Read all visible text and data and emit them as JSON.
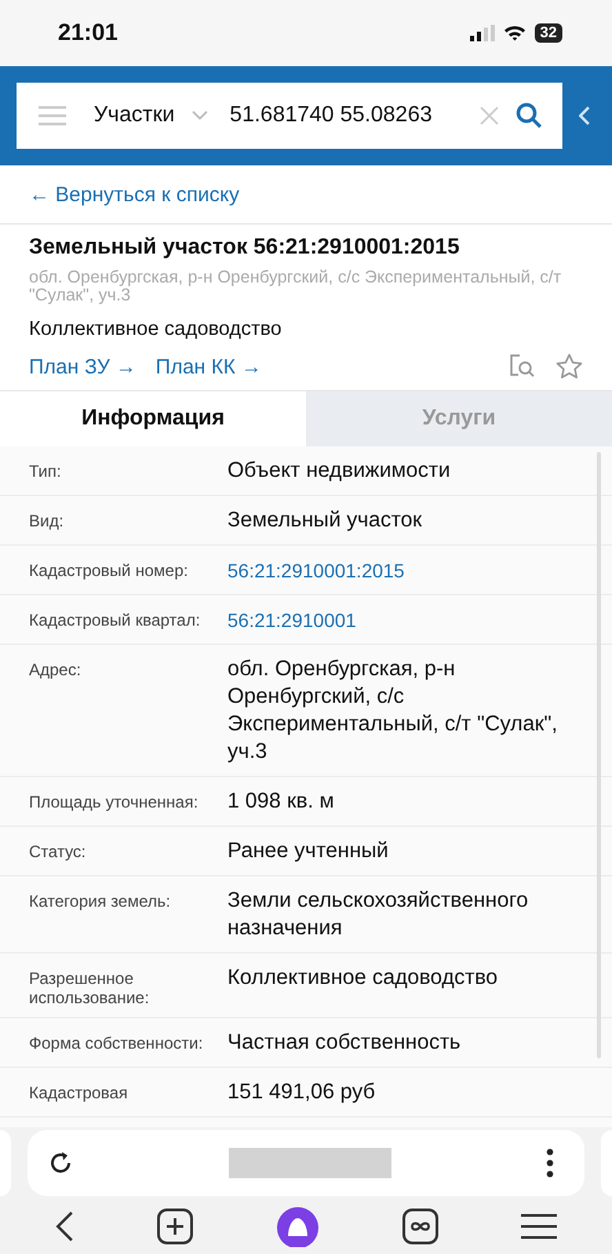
{
  "status_bar": {
    "time": "21:01",
    "battery": "32"
  },
  "search": {
    "category": "Участки",
    "value": "51.681740 55.08263"
  },
  "back_link": "← Вернуться к списку",
  "object": {
    "title": "Земельный участок 56:21:2910001:2015",
    "address": "обл. Оренбургская, р-н Оренбургский, с/с Экспериментальный, с/т \"Сулак\", уч.3",
    "usage": "Коллективное садоводство",
    "links": [
      "План ЗУ →",
      "План КК →"
    ]
  },
  "tabs": [
    {
      "label": "Информация",
      "selected": true
    },
    {
      "label": "Услуги",
      "selected": false
    }
  ],
  "rows": [
    {
      "label": "Тип:",
      "value": "Объект недвижимости",
      "link": false
    },
    {
      "label": "Вид:",
      "value": "Земельный участок",
      "link": false
    },
    {
      "label": "Кадастровый номер:",
      "value": "56:21:2910001:2015",
      "link": true
    },
    {
      "label": "Кадастровый квартал:",
      "value": "56:21:2910001",
      "link": true
    },
    {
      "label": "Адрес:",
      "value": "обл. Оренбургская, р-н Оренбургский, с/с Экспериментальный, с/т \"Сулак\", уч.3",
      "link": false
    },
    {
      "label": "Площадь уточненная:",
      "value": "1 098 кв. м",
      "link": false
    },
    {
      "label": "Статус:",
      "value": "Ранее учтенный",
      "link": false
    },
    {
      "label": "Категория земель:",
      "value": "Земли сельскохозяйственного назначения",
      "link": false
    },
    {
      "label": "Разрешенное использование:",
      "value": "Коллективное садоводство",
      "link": false
    },
    {
      "label": "Форма собственности:",
      "value": "Частная собственность",
      "link": false
    },
    {
      "label": "Кадастровая",
      "value": "151 491,06 руб",
      "link": false
    }
  ]
}
